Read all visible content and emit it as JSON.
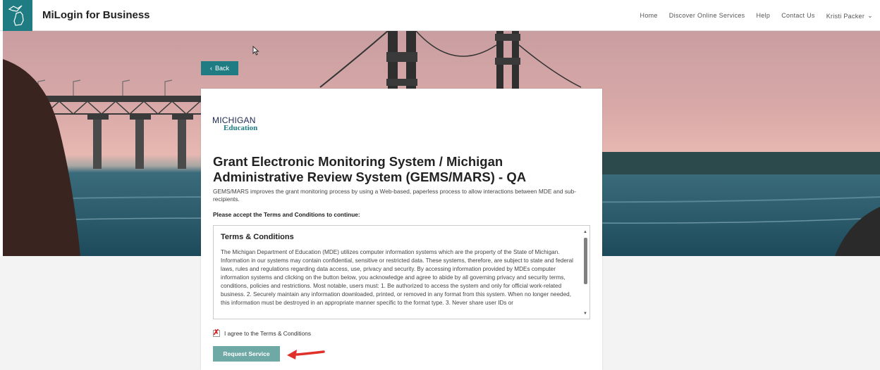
{
  "header": {
    "title": "MiLogin for Business",
    "nav": [
      "Home",
      "Discover Online Services",
      "Help",
      "Contact Us"
    ],
    "user_name": "Kristi Packer"
  },
  "back_label": "Back",
  "logo": {
    "line1": "MICHIGAN",
    "line2": "Education",
    "color": "#1f7c83"
  },
  "service": {
    "title": "Grant Electronic Monitoring System / Michigan Administrative Review System (GEMS/MARS) - QA",
    "description": "GEMS/MARS improves the grant monitoring process by using a Web-based, paperless process to allow interactions between MDE and sub-recipients."
  },
  "accept_prompt": "Please accept the Terms and Conditions to continue:",
  "terms": {
    "title": "Terms & Conditions",
    "body": "The Michigan Department of Education (MDE) utilizes computer information systems which are the property of the State of Michigan. Information in our systems may contain confidential, sensitive or restricted data. These systems, therefore, are subject to state and federal laws, rules and regulations regarding data access, use, privacy and security. By accessing information provided by MDEs computer information systems and clicking on the button below, you acknowledge and agree to abide by all governing privacy and security terms, conditions, policies and restrictions. Most notable, users must: 1. Be authorized to access the system and only for official work-related business. 2. Securely maintain any information downloaded, printed, or removed in any format from this system. When no longer needed, this information must be destroyed in an appropriate manner specific to the format type. 3. Never share user IDs or"
  },
  "agree_label": "I agree to the Terms & Conditions",
  "request_label": "Request Service",
  "colors": {
    "accent": "#1f7c83",
    "button_disabled": "#6fa9a6",
    "annotation_arrow": "#e0302a"
  }
}
